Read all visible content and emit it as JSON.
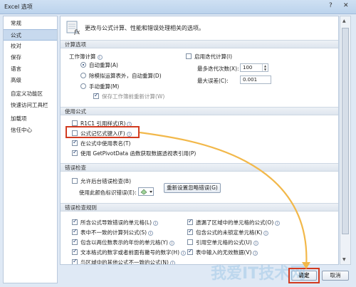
{
  "window": {
    "title": "Excel 选项",
    "help": "?",
    "close": "✕"
  },
  "sidebar": {
    "items": [
      "常规",
      "公式",
      "校对",
      "保存",
      "语言",
      "高级",
      "自定义功能区",
      "快速访问工具栏",
      "加载项",
      "信任中心"
    ],
    "active_index": 1
  },
  "header": {
    "text": "更改与公式计算、性能和错误处理相关的选项。"
  },
  "calc": {
    "section_title": "计算选项",
    "workbook_calc_label": "工作簿计算",
    "radios": [
      {
        "label": "自动重算(A)",
        "selected": true
      },
      {
        "label": "除模拟运算表外，自动重算(D)",
        "selected": false
      },
      {
        "label": "手动重算(M)",
        "selected": false
      }
    ],
    "save_recalc": {
      "label": "保存工作簿前重新计算(W)",
      "checked": true
    },
    "iterative": {
      "label": "启用迭代计算(I)",
      "checked": false
    },
    "max_iter_label": "最多迭代次数(X):",
    "max_iter_value": "100",
    "max_change_label": "最大误差(C):",
    "max_change_value": "0.001"
  },
  "formulas": {
    "section_title": "使用公式",
    "items": [
      {
        "label": "R1C1 引用样式(R)",
        "checked": false
      },
      {
        "label": "公式记忆式键入(F)",
        "checked": false
      },
      {
        "label": "在公式中使用表名(T)",
        "checked": true
      },
      {
        "label": "使用 GetPivotData 函数获取数据透视表引用(P)",
        "checked": true
      }
    ]
  },
  "errors": {
    "section_title": "错误检查",
    "bg_check": {
      "label": "允许后台错误检查(B)",
      "checked": false
    },
    "color_label": "使用此颜色标识错误(E):",
    "reset_button": "重新设置忽略错误(G)"
  },
  "rules": {
    "section_title": "错误检查规则",
    "left": [
      {
        "label": "所含公式导致错误的单元格(L)",
        "checked": true
      },
      {
        "label": "表中不一致的计算列公式(S)",
        "checked": true
      },
      {
        "label": "包含以两位数表示的年份的单元格(Y)",
        "checked": true
      },
      {
        "label": "文本格式的数字或者前面有撇号的数字(H)",
        "checked": true
      },
      {
        "label": "与区域中的其他公式不一致的公式(N)",
        "checked": true
      }
    ],
    "right": [
      {
        "label": "遗漏了区域中的单元格的公式(O)",
        "checked": true
      },
      {
        "label": "包含公式的未锁定单元格(K)",
        "checked": true
      },
      {
        "label": "引用空单元格的公式(U)",
        "checked": false
      },
      {
        "label": "表中输入的无效数据(V)",
        "checked": true
      }
    ]
  },
  "footer": {
    "ok": "确定",
    "cancel": "取消"
  },
  "watermark": "我爱IT技术网",
  "colors": {
    "highlight": "#d23b20",
    "arrow": "#f2b84a",
    "accent": "#c7d9ee"
  }
}
